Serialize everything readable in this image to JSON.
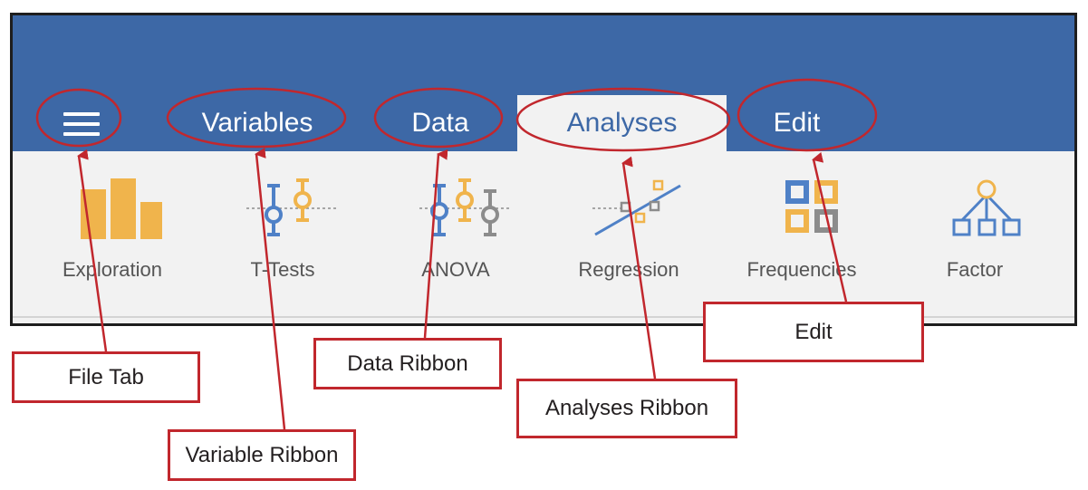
{
  "tabs": {
    "variables": "Variables",
    "data": "Data",
    "analyses": "Analyses",
    "edit": "Edit"
  },
  "ribbon": [
    {
      "key": "exploration",
      "label": "Exploration",
      "icon": "exploration-icon"
    },
    {
      "key": "t-tests",
      "label": "T-Tests",
      "icon": "t-tests-icon"
    },
    {
      "key": "anova",
      "label": "ANOVA",
      "icon": "anova-icon"
    },
    {
      "key": "regression",
      "label": "Regression",
      "icon": "regression-icon"
    },
    {
      "key": "frequencies",
      "label": "Frequencies",
      "icon": "frequencies-icon"
    },
    {
      "key": "factor",
      "label": "Factor",
      "icon": "factor-icon"
    }
  ],
  "callouts": {
    "file_tab": "File Tab",
    "variable_ribbon": "Variable Ribbon",
    "data_ribbon": "Data Ribbon",
    "analyses_ribbon": "Analyses Ribbon",
    "edit": "Edit"
  },
  "colors": {
    "header": "#3d68a6",
    "ribbon": "#f2f2f2",
    "annotation": "#c1272d",
    "icon_orange": "#f0b44c",
    "icon_blue": "#4f81c7",
    "icon_gray": "#8c8c8c"
  }
}
